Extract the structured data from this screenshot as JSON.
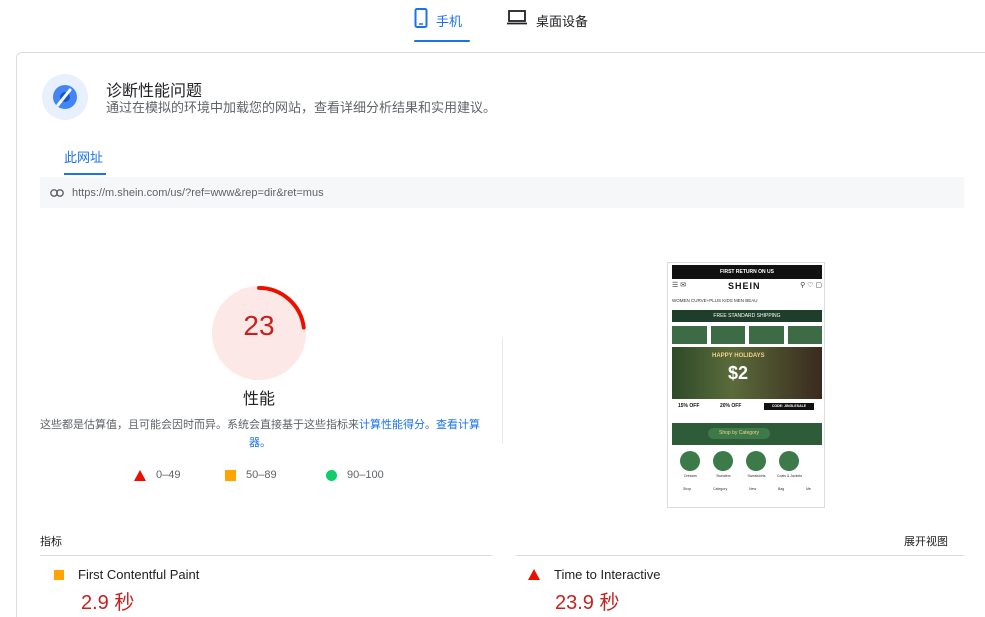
{
  "device_tabs": [
    {
      "label": "手机",
      "icon": "phone-icon",
      "active": true
    },
    {
      "label": "桌面设备",
      "icon": "laptop-icon",
      "active": false
    }
  ],
  "diagnose": {
    "title": "诊断性能问题",
    "subtitle": "通过在模拟的环境中加载您的网站，查看详细分析结果和实用建议。"
  },
  "url_tab": {
    "label": "此网址"
  },
  "url": {
    "text": "https://m.shein.com/us/?ref=www&rep=dir&ret=mus"
  },
  "score": {
    "value": "23",
    "fraction": 0.23,
    "label": "性能",
    "color": "#c5221f"
  },
  "desc": {
    "text": "这些都是估算值，且可能会因时而异。系统会直接基于这些指标来",
    "link1": "计算性能得分",
    "sep": "。",
    "link2": "查看计算器。"
  },
  "legend": [
    {
      "range": "0–49",
      "shape": "triangle",
      "color": "#eb0f00"
    },
    {
      "range": "50–89",
      "shape": "square",
      "color": "#ffa400"
    },
    {
      "range": "90–100",
      "shape": "circle",
      "color": "#0cce6b"
    }
  ],
  "phone_preview": {
    "banner": "FIRST RETURN ON US",
    "logo": "SHEIN",
    "nav": "WOMEN   CURVE+PLUS   KIDS   MEN   BEAU",
    "shipping": "FREE STANDARD SHIPPING",
    "hero_line1": "HAPPY HOLIDAYS",
    "hero_line2": "$2",
    "offer1": "15% OFF",
    "offer2": "20% OFF",
    "offer3": "CODE: JINGLESALE",
    "shop_button": "Shop by Category",
    "circle_labels": [
      "Dresses",
      "Sweaters",
      "Sweatshirts",
      "Coats & Jackets"
    ],
    "bottom_nav": [
      "Shop",
      "Category",
      "New",
      "Bag",
      "Me"
    ]
  },
  "metrics": {
    "label": "指标",
    "expand": "展开视图",
    "items": [
      {
        "name": "First Contentful Paint",
        "value": "2.9 秒",
        "rating": "average"
      },
      {
        "name": "Time to Interactive",
        "value": "23.9 秒",
        "rating": "fail"
      }
    ]
  }
}
